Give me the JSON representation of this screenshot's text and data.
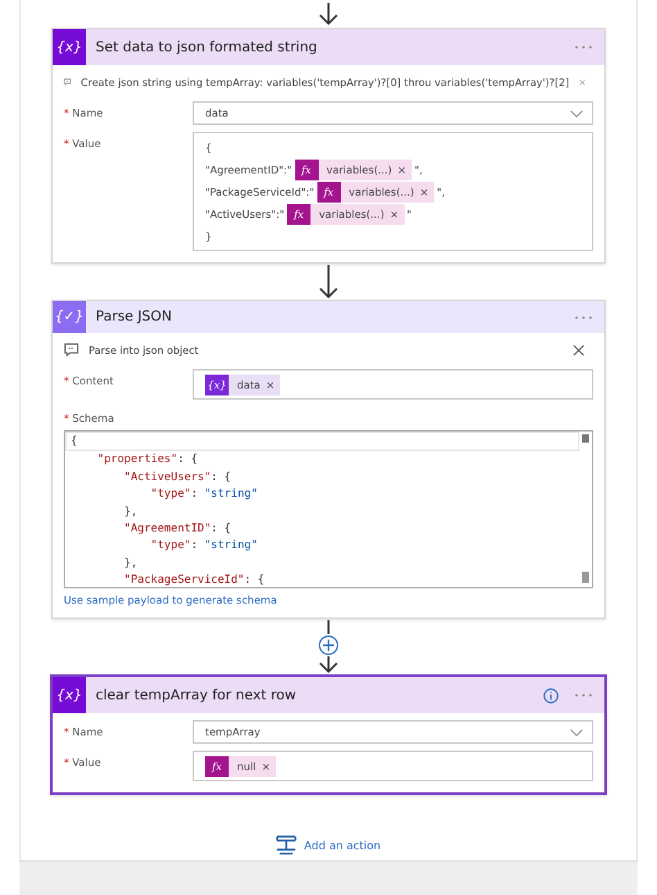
{
  "actions": [
    {
      "kind": "variable",
      "icon": "{x}",
      "title": "Set data to json formated string",
      "selected": false,
      "info": false,
      "comment": "Create json string using tempArray: variables('tempArray')?[0] throu variables('tempArray')?[2]",
      "fields": [
        {
          "kind": "dropdown",
          "label": "*",
          "name": "Name",
          "value": "data"
        },
        {
          "kind": "multiline",
          "label": "*",
          "name": "Value",
          "lines": [
            [
              {
                "kind": "text",
                "text": "{"
              }
            ],
            [
              {
                "kind": "text",
                "text": "\"AgreementID\":\""
              },
              {
                "kind": "expression",
                "icon": "fx",
                "text": "variables(...)",
                "remove": "×"
              },
              {
                "kind": "text",
                "text": "\","
              }
            ],
            [
              {
                "kind": "text",
                "text": "\"PackageServiceId\":\""
              },
              {
                "kind": "expression",
                "icon": "fx",
                "text": "variables(...)",
                "remove": "×"
              },
              {
                "kind": "text",
                "text": "\","
              }
            ],
            [
              {
                "kind": "text",
                "text": "\"ActiveUsers\":\""
              },
              {
                "kind": "expression",
                "icon": "fx",
                "text": "variables(...)",
                "remove": "×"
              },
              {
                "kind": "text",
                "text": "\""
              }
            ],
            [
              {
                "kind": "text",
                "text": "}"
              }
            ]
          ]
        }
      ]
    },
    {
      "kind": "data_operation",
      "icon": "{✓}",
      "title": "Parse JSON",
      "selected": false,
      "info": false,
      "comment": "Parse into json object",
      "fields": [
        {
          "kind": "tokens",
          "label": "*",
          "name": "Content",
          "lines": [
            [
              {
                "kind": "variable",
                "icon": "{x}",
                "text": "data",
                "remove": "×"
              }
            ]
          ]
        },
        {
          "kind": "code",
          "label": "*",
          "name": "Schema",
          "code": [
            "{",
            "    \"properties\": {",
            "        \"ActiveUsers\": {",
            "            \"type\": \"string\"",
            "        },",
            "        \"AgreementID\": {",
            "            \"type\": \"string\"",
            "        },",
            "        \"PackageServiceId\": {"
          ],
          "link": "Use sample payload to generate schema"
        }
      ]
    },
    {
      "kind": "variable",
      "icon": "{x}",
      "title": "clear tempArray for next row",
      "selected": true,
      "info": true,
      "fields": [
        {
          "kind": "dropdown",
          "label": "*",
          "name": "Name",
          "value": "tempArray"
        },
        {
          "kind": "tokens",
          "label": "*",
          "name": "Value",
          "lines": [
            [
              {
                "kind": "expression",
                "icon": "fx",
                "text": "null",
                "remove": "×"
              }
            ]
          ]
        }
      ]
    }
  ],
  "connectors": [
    {
      "kind": "arrow"
    },
    {
      "kind": "arrow"
    },
    {
      "kind": "insert"
    }
  ],
  "add_action": {
    "label": "Add an action"
  }
}
